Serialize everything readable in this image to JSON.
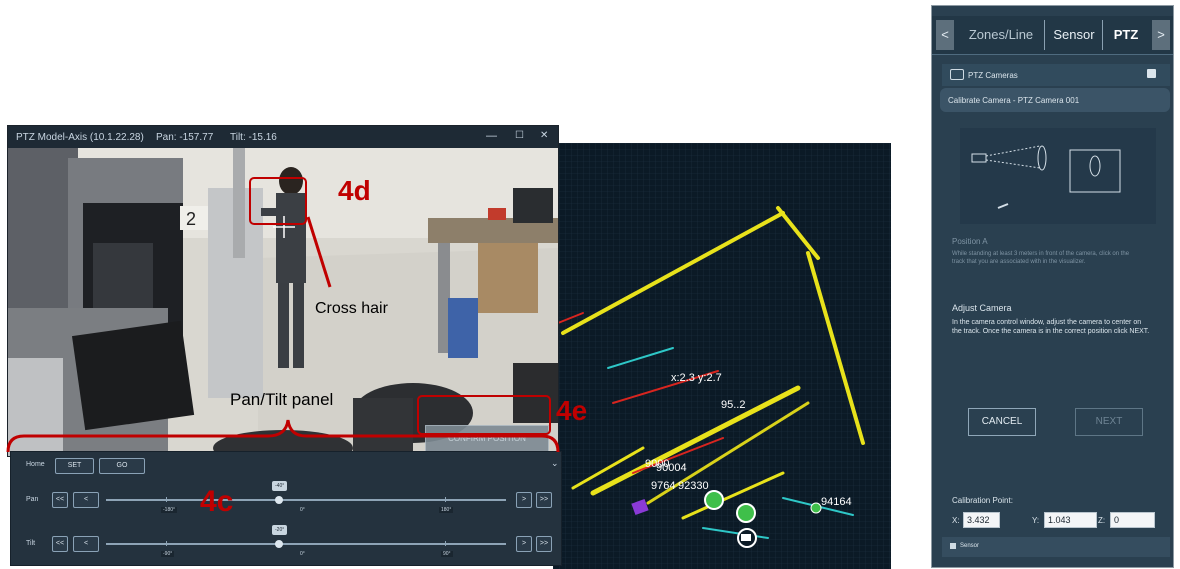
{
  "camera_window": {
    "title": "PTZ Model-Axis (10.1.22.28)",
    "pan_readout": "Pan: -157.77",
    "tilt_readout": "Tilt: -15.16",
    "minimize_glyph": "—",
    "maximize_glyph": "☐",
    "close_glyph": "✕",
    "confirm_position_label": "CONFIRM POSITION"
  },
  "pan_tilt_panel": {
    "home_label": "Home",
    "set_label": "SET",
    "go_label": "GO",
    "collapse_glyph": "⌄",
    "pan": {
      "label": "Pan",
      "value_tag": "-40°",
      "value": -40,
      "min_label": "-180°",
      "mid_label": "0°",
      "max_label": "180°",
      "fast_left": "<<",
      "left": "<",
      "right": ">",
      "fast_right": ">>"
    },
    "tilt": {
      "label": "Tilt",
      "value_tag": "-20°",
      "value": -20,
      "min_label": "-90°",
      "mid_label": "0°",
      "max_label": "90°",
      "fast_left": "<<",
      "left": "<",
      "right": ">",
      "fast_right": ">>"
    }
  },
  "map": {
    "coord_readout": "x:2.3 y:2.7",
    "track_labels": [
      "9000",
      "90004",
      "9764",
      "92330",
      "94164",
      "95..2"
    ]
  },
  "annotations": {
    "label_4d": "4d",
    "label_4e": "4e",
    "label_4c": "4c",
    "cross_hair": "Cross hair",
    "pan_tilt_panel": "Pan/Tilt panel",
    "color": "#c00000"
  },
  "right_panel": {
    "tab_prev": "<",
    "tab_zones": "Zones/Line",
    "tab_sensor": "Sensor",
    "tab_ptz": "PTZ",
    "tab_next": ">",
    "section_title": "PTZ Cameras",
    "calibrate_title": "Calibrate Camera - PTZ Camera 001",
    "position_a_title": "Position A",
    "position_a_text": "While standing at least 3 meters in front of the camera, click on the track that you are associated with in the visualizer.",
    "adjust_title": "Adjust Camera",
    "adjust_text": "In the camera control window, adjust the camera to center on the track. Once the camera is in the correct position click NEXT.",
    "cancel_label": "CANCEL",
    "next_label": "NEXT",
    "calibration_point_label": "Calibration Point:",
    "x_label": "X:",
    "x_value": "3.432",
    "y_label": "Y:",
    "y_value": "1.043",
    "z_label": "Z:",
    "z_value": "0",
    "footer_label": "Sensor"
  }
}
